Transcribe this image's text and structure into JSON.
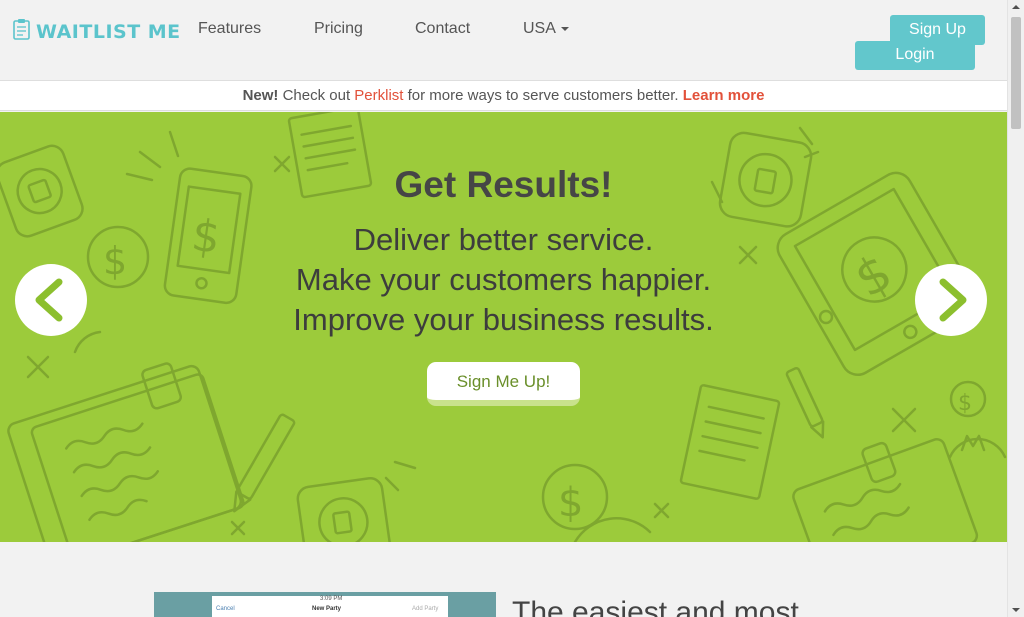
{
  "brand": {
    "name": "WAITLIST ME",
    "logo_icon": "clipboard-icon",
    "accent": "#5bc4cc"
  },
  "nav": {
    "items": [
      {
        "label": "Features"
      },
      {
        "label": "Pricing"
      },
      {
        "label": "Contact"
      }
    ],
    "country": {
      "label": "USA",
      "icon": "caret-down-icon"
    },
    "signup_label": "Sign Up",
    "login_label": "Login"
  },
  "announcement": {
    "new_label": "New!",
    "text_before": " Check out ",
    "product": "Perklist",
    "text_after": " for more ways to serve customers better. ",
    "link_label": "Learn more",
    "link_color": "#e2513a"
  },
  "hero": {
    "title": "Get Results!",
    "lines": [
      "Deliver better service.",
      "Make your customers happier.",
      "Improve your business results."
    ],
    "cta_label": "Sign Me Up!",
    "background": "#9ccb3b",
    "prev_icon": "chevron-left-icon",
    "next_icon": "chevron-right-icon"
  },
  "below": {
    "heading": "The easiest and most",
    "screenshot": {
      "cancel": "Cancel",
      "title": "New Party",
      "action": "Add Party",
      "time": "3:09 PM"
    }
  }
}
